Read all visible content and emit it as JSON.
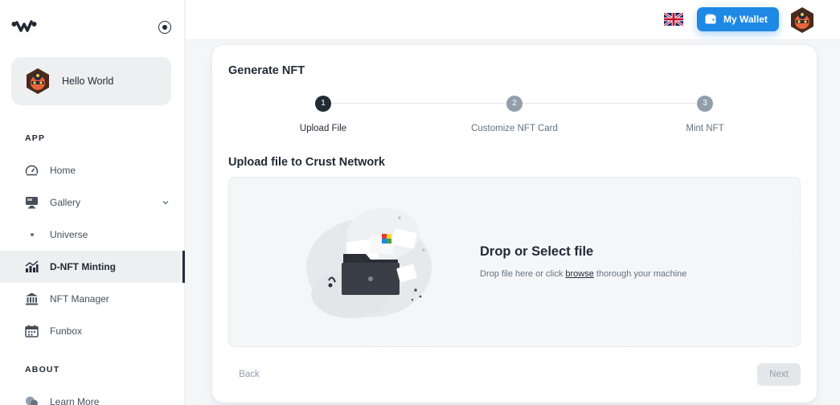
{
  "sidebar": {
    "account_name": "Hello World",
    "sections": {
      "app": "APP",
      "about": "ABOUT"
    },
    "items": {
      "home": "Home",
      "gallery": "Gallery",
      "universe": "Universe",
      "minting": "D-NFT Minting",
      "manager": "NFT Manager",
      "funbox": "Funbox",
      "learn": "Learn More"
    }
  },
  "header": {
    "wallet_label": "My Wallet",
    "language_icon": "uk-flag-icon"
  },
  "card": {
    "title": "Generate NFT",
    "steps": [
      {
        "number": "1",
        "label": "Upload File"
      },
      {
        "number": "2",
        "label": "Customize NFT Card"
      },
      {
        "number": "3",
        "label": "Mint NFT"
      }
    ],
    "section_title": "Upload file to Crust Network",
    "dropzone": {
      "title": "Drop or Select file",
      "desc_before": "Drop file here or click ",
      "desc_link": "browse",
      "desc_after": " thorough your machine"
    },
    "back_label": "Back",
    "next_label": "Next"
  },
  "colors": {
    "accent": "#1e88e5",
    "active_text": "#212b36",
    "muted": "#637381"
  }
}
